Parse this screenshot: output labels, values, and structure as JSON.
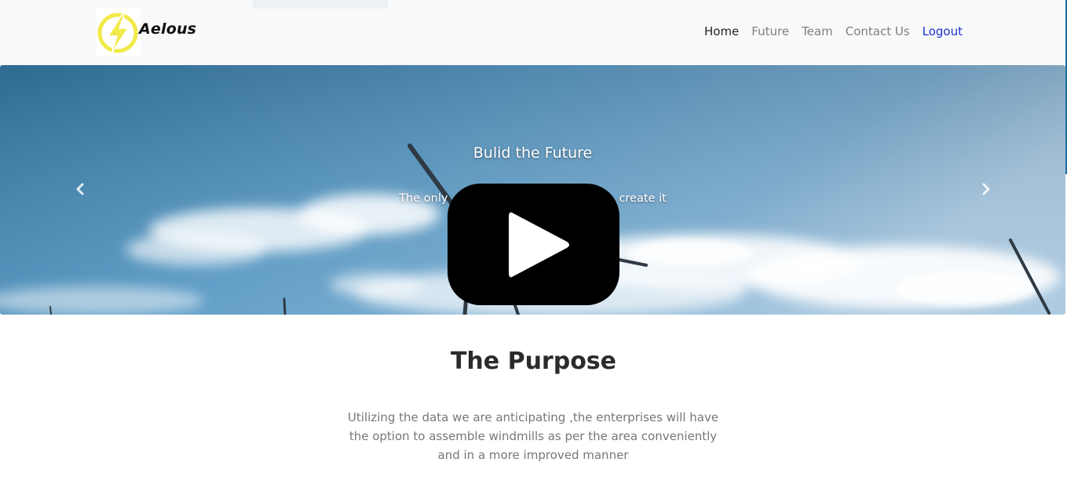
{
  "navbar": {
    "brand_name": "Aelous",
    "links": [
      {
        "label": "Home"
      },
      {
        "label": "Future"
      },
      {
        "label": "Team"
      },
      {
        "label": "Contact Us"
      },
      {
        "label": "Logout"
      }
    ]
  },
  "hero": {
    "title": "Bulid the Future",
    "text": "The only [obscured] create it",
    "text_left": "The only",
    "text_right": "create it"
  },
  "purpose": {
    "title": "The Purpose",
    "text": "Utilizing the data we are anticipating ,the enterprises will have the option to assemble windmills as per the area conveniently and in a more improved manner"
  },
  "colors": {
    "navbar_bg": "#f8f9fa",
    "logout_link": "#1a31c9",
    "logo_yellow": "#f0ea4a",
    "sky_blue": "#4d8fbb"
  },
  "icons": [
    "lightning-logo-icon",
    "chevron-left-icon",
    "chevron-right-icon",
    "play-icon"
  ]
}
